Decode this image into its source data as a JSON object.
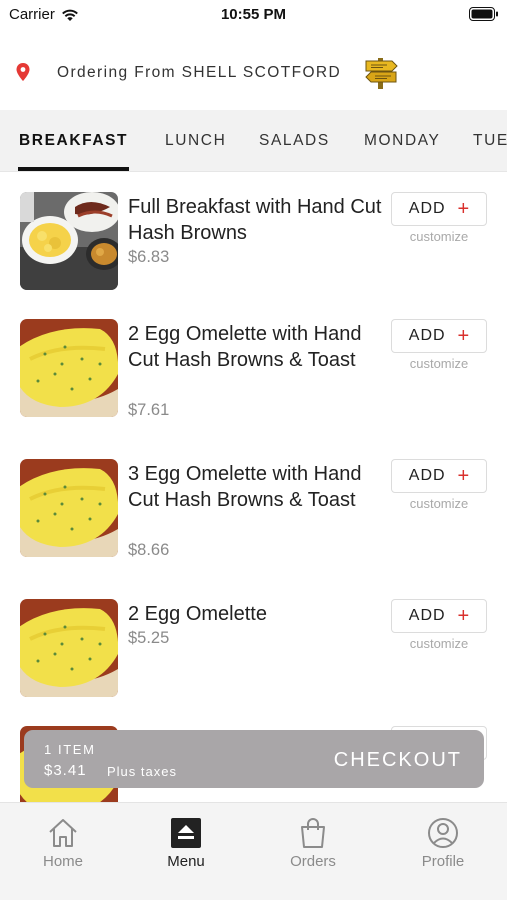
{
  "status_bar": {
    "carrier": "Carrier",
    "time": "10:55 PM"
  },
  "location": {
    "text": "Ordering From SHELL SCOTFORD"
  },
  "tabs": [
    {
      "label": "BREAKFAST",
      "active": true
    },
    {
      "label": "LUNCH",
      "active": false
    },
    {
      "label": "SALADS",
      "active": false
    },
    {
      "label": "MONDAY",
      "active": false
    },
    {
      "label": "TUE",
      "active": false
    }
  ],
  "menu": {
    "add_label": "ADD",
    "customize_label": "customize",
    "items": [
      {
        "name": "Full Breakfast with Hand Cut Hash Browns",
        "price": "$6.83"
      },
      {
        "name": "2 Egg Omelette with Hand Cut Hash Browns & Toast",
        "price": "$7.61"
      },
      {
        "name": "3 Egg Omelette with Hand Cut Hash Browns & Toast",
        "price": "$8.66"
      },
      {
        "name": "2 Egg Omelette",
        "price": "$5.25"
      }
    ]
  },
  "checkout": {
    "item_count": "1 ITEM",
    "total": "$3.41",
    "taxes_note": "Plus taxes",
    "label": "CHECKOUT"
  },
  "nav": [
    {
      "label": "Home",
      "icon": "home-icon",
      "active": false
    },
    {
      "label": "Menu",
      "icon": "menu-icon",
      "active": true
    },
    {
      "label": "Orders",
      "icon": "shopping-bag-icon",
      "active": false
    },
    {
      "label": "Profile",
      "icon": "profile-icon",
      "active": false
    }
  ],
  "colors": {
    "accent_red": "#d9302c",
    "checkout_bg": "#a9a6a8",
    "tab_bar_bg": "#f2f2f2"
  }
}
